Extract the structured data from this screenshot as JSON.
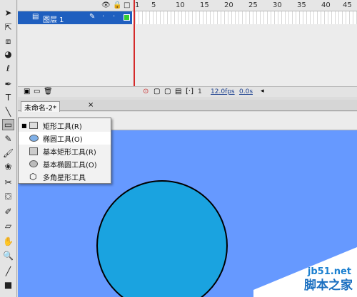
{
  "tools": [
    "arrow",
    "subselect",
    "free-transform",
    "lasso-3d",
    "lasso",
    "pen",
    "text",
    "line",
    "rectangle",
    "pencil",
    "brush",
    "deco",
    "bone",
    "paint-bucket",
    "eyedropper",
    "eraser",
    "hand",
    "zoom",
    "stroke-color",
    "fill-color"
  ],
  "timeline": {
    "frame_numbers": [
      "1",
      "5",
      "10",
      "15",
      "20",
      "25",
      "30",
      "35",
      "40",
      "45"
    ],
    "layer_name": "图层 1",
    "fps": "12.0fps",
    "time": "0.0s",
    "current_frame": "1"
  },
  "document": {
    "tab_name": "未命名-2*",
    "close_glyph": "×"
  },
  "tool_menu": {
    "items": [
      {
        "label": "矩形工具(R)",
        "icon": "rectangle-icon",
        "selected": true
      },
      {
        "label": "椭圆工具(O)",
        "icon": "ellipse-icon",
        "selected": false
      },
      {
        "label": "基本矩形工具(R)",
        "icon": "primitive-rectangle-icon",
        "selected": false
      },
      {
        "label": "基本椭圆工具(O)",
        "icon": "primitive-ellipse-icon",
        "selected": false
      },
      {
        "label": "多角星形工具",
        "icon": "polystar-icon",
        "selected": false
      }
    ],
    "highlighted_index": 1
  },
  "stage": {
    "background": "#6699ff",
    "shape_fill": "#1aa3e0"
  },
  "watermark": {
    "site": "jb51.net",
    "brand": "脚本之家"
  }
}
